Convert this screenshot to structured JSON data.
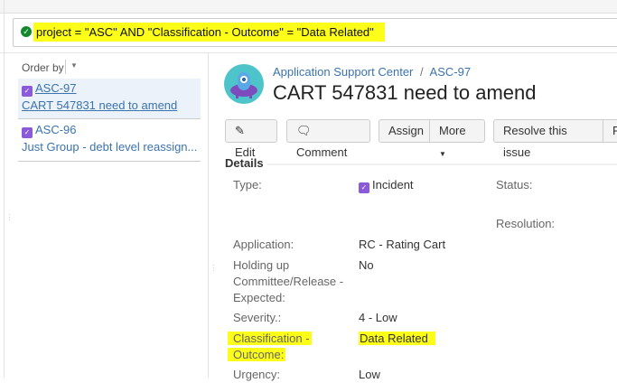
{
  "search": {
    "query": "project = \"ASC\" AND \"Classification - Outcome\" = \"Data Related\""
  },
  "sidebar": {
    "order_by": "Order by",
    "items": [
      {
        "key": "ASC-97",
        "summary": "CART 547831 need to amend"
      },
      {
        "key": "ASC-96",
        "summary": "Just Group - debt level reassign..."
      }
    ]
  },
  "issue": {
    "project": "Application Support Center",
    "separator": "/",
    "key": "ASC-97",
    "title": "CART 547831 need to amend"
  },
  "toolbar": {
    "edit": "Edit",
    "comment": "Comment",
    "assign": "Assign",
    "more": "More",
    "resolve": "Resolve this issue",
    "next": "R"
  },
  "details": {
    "heading": "Details",
    "type_label": "Type:",
    "type_value": "Incident",
    "status_label": "Status:",
    "resolution_label": "Resolution:",
    "application_label": "Application:",
    "application_value": "RC - Rating Cart",
    "holding_label_1": "Holding up",
    "holding_label_2": "Committee/Release -",
    "holding_label_3": "Expected:",
    "holding_value": "No",
    "severity_label": "Severity.:",
    "severity_value": "4 - Low",
    "classification_label_1": "Classification -",
    "classification_label_2": "Outcome:",
    "classification_value": "Data Related",
    "urgency_label": "Urgency:",
    "urgency_value": "Low"
  }
}
